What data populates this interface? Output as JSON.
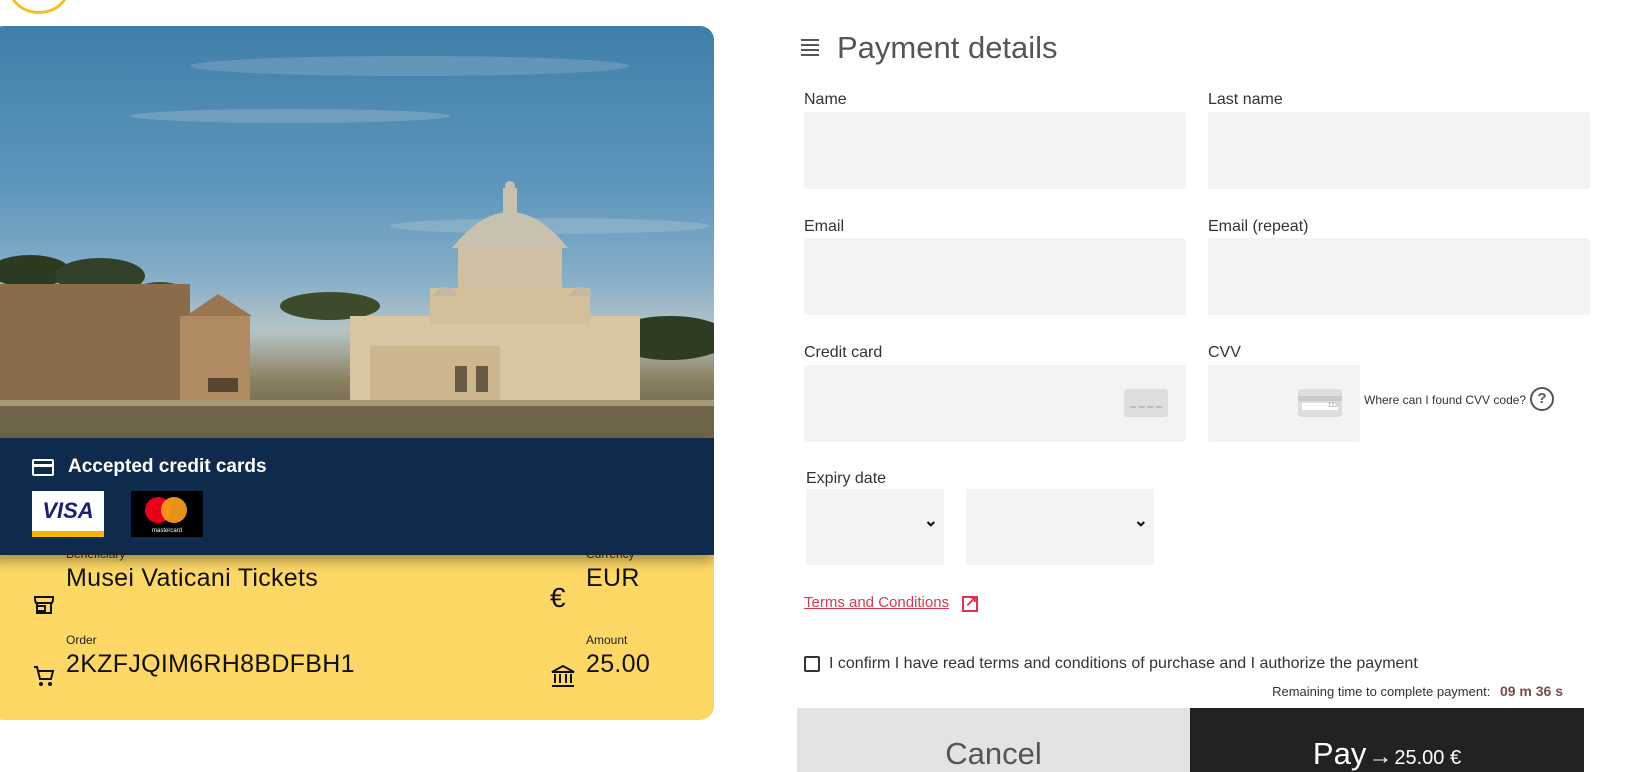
{
  "left_panel": {
    "accepted_cards": {
      "title": "Accepted credit cards",
      "cards": [
        {
          "name": "VISA",
          "color": "#1a1f71"
        },
        {
          "name": "mastercard",
          "color": "#eb001b"
        }
      ]
    },
    "beneficiary": {
      "label": "Beneficiary",
      "value": "Musei Vaticani Tickets"
    },
    "currency": {
      "label": "Currency",
      "value": "EUR"
    },
    "order": {
      "label": "Order",
      "value": "2KZFJQIM6RH8BDFBH1"
    },
    "amount": {
      "label": "Amount",
      "value": "25.00"
    },
    "colors": {
      "accent": "#fed866",
      "band": "#0e2a4d"
    }
  },
  "form": {
    "title": "Payment details",
    "fields": {
      "name": {
        "label": "Name",
        "value": ""
      },
      "last_name": {
        "label": "Last name",
        "value": ""
      },
      "email": {
        "label": "Email",
        "value": ""
      },
      "email_repeat": {
        "label": "Email (repeat)",
        "value": ""
      },
      "credit_card": {
        "label": "Credit card",
        "value": ""
      },
      "cvv": {
        "label": "CVV",
        "value": "",
        "card_hint": "123"
      }
    },
    "cvv_help": "Where can I found CVV code?",
    "expiry": {
      "label": "Expiry date",
      "month": "",
      "year": ""
    },
    "terms_link": "Terms and Conditions",
    "confirm_text": "I confirm I have read terms and conditions of purchase and I authorize the payment",
    "confirm_checked": false,
    "remaining_label": "Remaining time to complete payment:",
    "remaining_value": "09 m 36 s",
    "cancel_label": "Cancel",
    "pay_label": "Pay",
    "pay_amount": "25.00 €"
  }
}
